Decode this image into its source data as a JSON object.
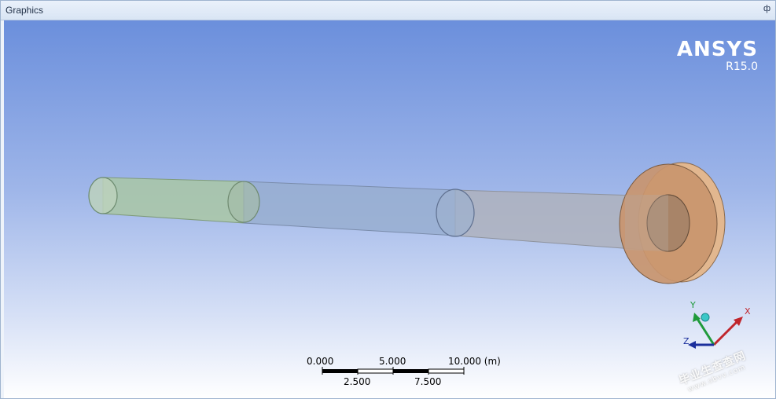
{
  "window": {
    "title": "Graphics",
    "pin_glyph": "ф"
  },
  "branding": {
    "name": "ANSYS",
    "version": "R15.0"
  },
  "scale_bar": {
    "top_labels": [
      "0.000",
      "5.000",
      "10.000 (m)"
    ],
    "bottom_labels": [
      "2.500",
      "7.500"
    ]
  },
  "triad": {
    "x_label": "X",
    "y_label": "Y",
    "z_label": "Z"
  },
  "watermark": {
    "text": "毕业生查查网",
    "url": "www.sbvv.com"
  },
  "colors": {
    "viewport_top": "#6b8fdc",
    "viewport_bottom": "#ffffff",
    "pipe_green": "#a9c7a4",
    "pipe_blue": "#98aed0",
    "pipe_gray": "#aeb2bd",
    "flange": "#c9956e",
    "axis_x": "#c0262d",
    "axis_y": "#1f9a3a",
    "axis_z": "#1b2f9c"
  }
}
